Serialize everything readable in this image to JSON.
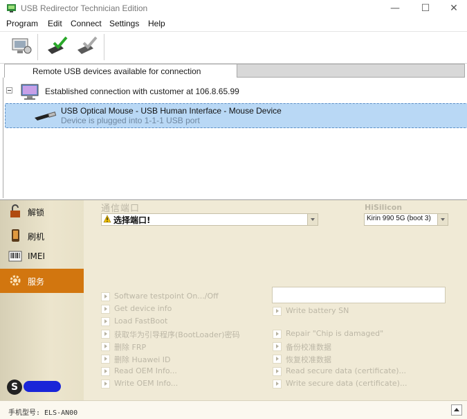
{
  "window": {
    "title": "USB Redirector Technician Edition",
    "controls": {
      "minimize": "—",
      "maximize": "☐",
      "close": "✕"
    }
  },
  "menu": [
    "Program",
    "Edit",
    "Connect",
    "Settings",
    "Help"
  ],
  "toolbar": {
    "buttons": [
      {
        "icon": "computer-settings-icon"
      },
      {
        "icon": "connect-device-icon"
      },
      {
        "icon": "disconnect-device-icon"
      }
    ]
  },
  "tabs": {
    "active": "Remote USB devices available for connection"
  },
  "tree": {
    "connection": "Established connection with customer at 106.8.65.99",
    "device": {
      "name": "USB Optical Mouse - USB Human Interface - Mouse Device",
      "status": "Device is plugged into 1-1-1 USB port"
    }
  },
  "sidebar": {
    "items": [
      {
        "label": "解锁",
        "icon": "unlock-icon"
      },
      {
        "label": "刷机",
        "icon": "phone-flash-icon"
      },
      {
        "label": "IMEI",
        "icon": "barcode-icon"
      },
      {
        "label": "服务",
        "icon": "gear-icon",
        "active": true
      }
    ],
    "avatar_letter": "S"
  },
  "main": {
    "port_label": "通信端口",
    "port_value": "选择端口!",
    "vendor_label": "HiSilicon",
    "chip_value": "Kirin 990 5G (boot 3)",
    "actions_left": [
      "Software testpoint On.../Off",
      "Get device info",
      "Load FastBoot",
      "获取华为引导程序(BootLoader)密码",
      "删除 FRP",
      "删除 Huawei ID",
      "Read OEM Info...",
      "Write OEM Info..."
    ],
    "actions_right": [
      "Write battery SN",
      "Repair \"Chip is damaged\"",
      "备份校准数据",
      "恢复校准数据",
      "Read secure data (certificate)...",
      "Write secure data (certificate)..."
    ]
  },
  "footer": {
    "phone_model": "手机型号: ELS-AN00"
  },
  "colors": {
    "accent": "#d2760f",
    "selection": "#b9d8f5",
    "panel": "#f0ead6"
  }
}
